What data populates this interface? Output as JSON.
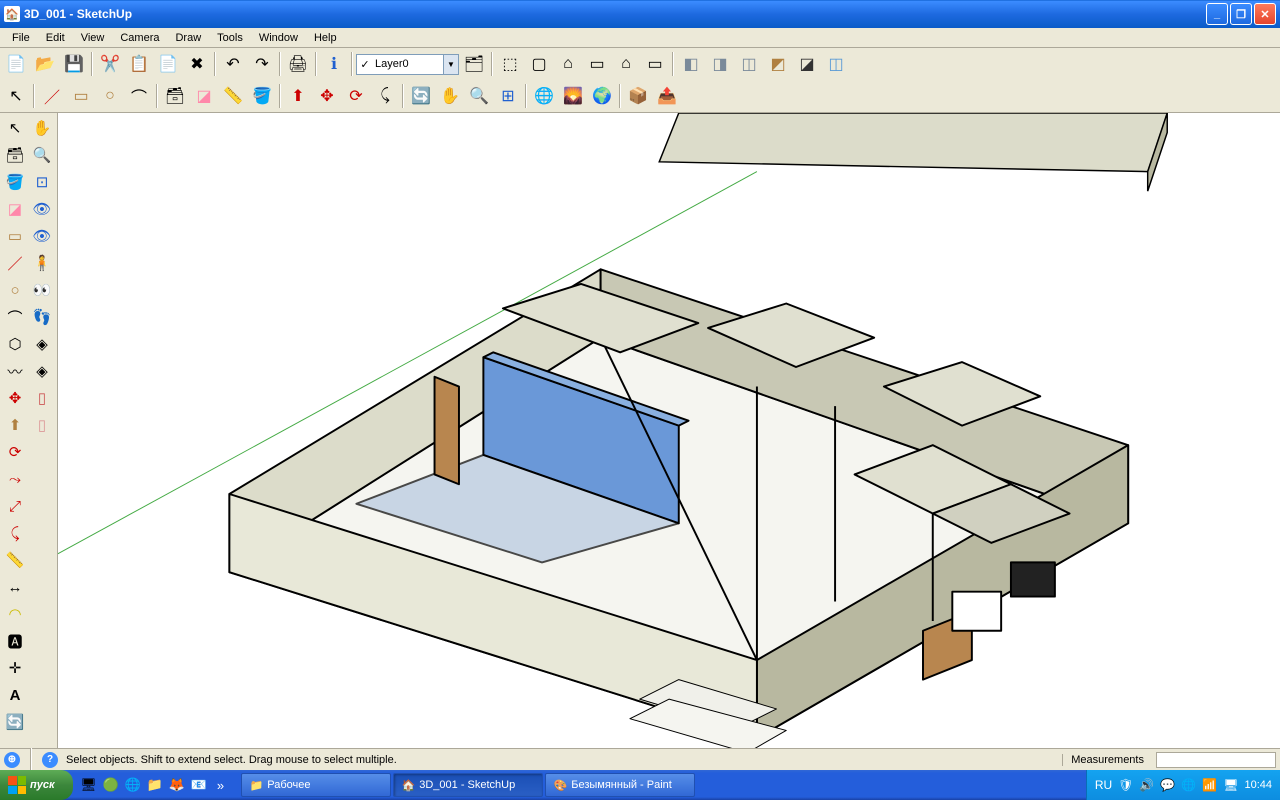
{
  "window": {
    "title": "3D_001 - SketchUp",
    "app_icon": "🏠"
  },
  "menu": [
    "File",
    "Edit",
    "View",
    "Camera",
    "Draw",
    "Tools",
    "Window",
    "Help"
  ],
  "layer": {
    "current": "Layer0"
  },
  "status": {
    "hint": "Select objects. Shift to extend select. Drag mouse to select multiple.",
    "measurements_label": "Measurements"
  },
  "taskbar": {
    "start": "пуск",
    "tasks": [
      {
        "label": "Рабочее",
        "icon": "📁",
        "active": false
      },
      {
        "label": "3D_001 - SketchUp",
        "icon": "🏠",
        "active": true
      },
      {
        "label": "Безымянный - Paint",
        "icon": "🎨",
        "active": false
      }
    ],
    "lang": "RU",
    "clock": "10:44"
  }
}
